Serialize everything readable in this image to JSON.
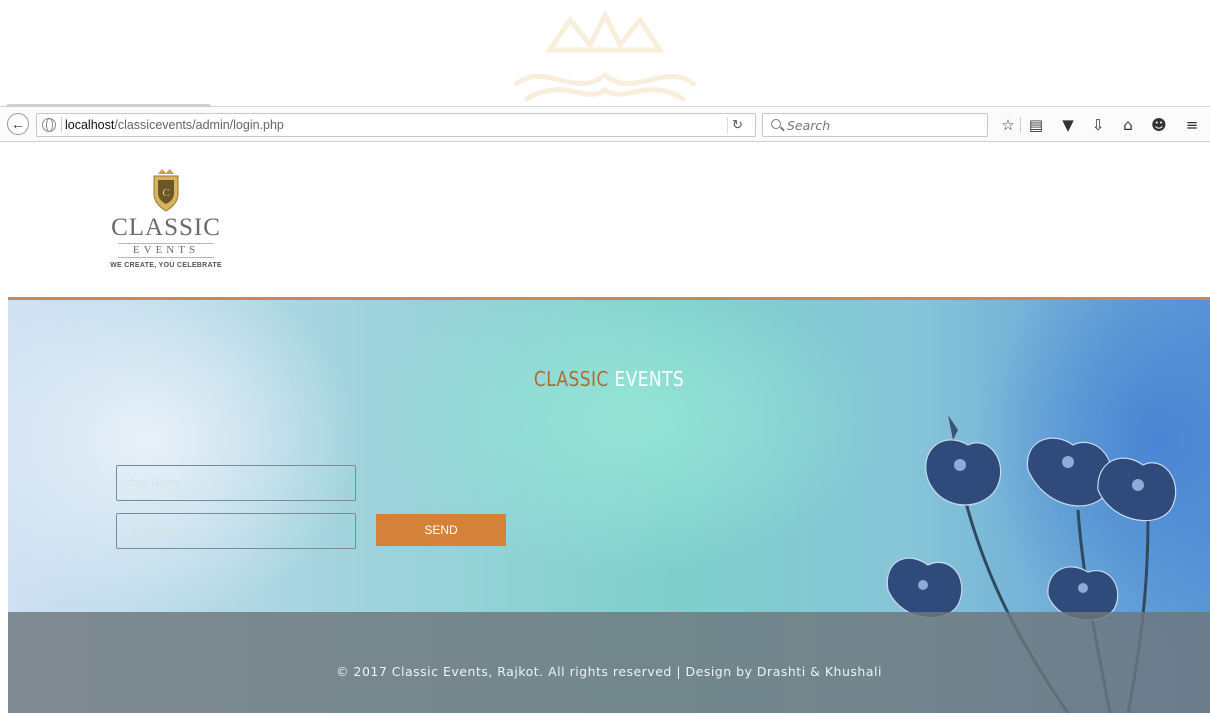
{
  "browser": {
    "url_host": "localhost",
    "url_path": "/classicevents/admin/login.php",
    "search_placeholder": "Search",
    "icons": [
      "back-icon",
      "globe-icon",
      "reload-icon",
      "search-icon",
      "bookmark-star-icon",
      "reading-list-icon",
      "pocket-icon",
      "download-icon",
      "home-icon",
      "smiley-icon",
      "menu-icon"
    ]
  },
  "header": {
    "logo_title": "CLASSIC",
    "logo_subtitle": "EVENTS",
    "logo_tagline": "WE CREATE, YOU CELEBRATE"
  },
  "hero": {
    "title_part1": "CLASSIC",
    "title_part2": "EVENTS",
    "name_placeholder": "Your Name",
    "password_placeholder": "Password",
    "send_label": "SEND"
  },
  "footer": {
    "text": "© 2017 Classic Events, Rajkot. All rights reserved | Design by Drashti & Khushali"
  },
  "colors": {
    "accent": "#d4823a",
    "title_brown": "#b36a2e",
    "header_line": "#c7895a",
    "footer_bg": "#6e767d"
  }
}
